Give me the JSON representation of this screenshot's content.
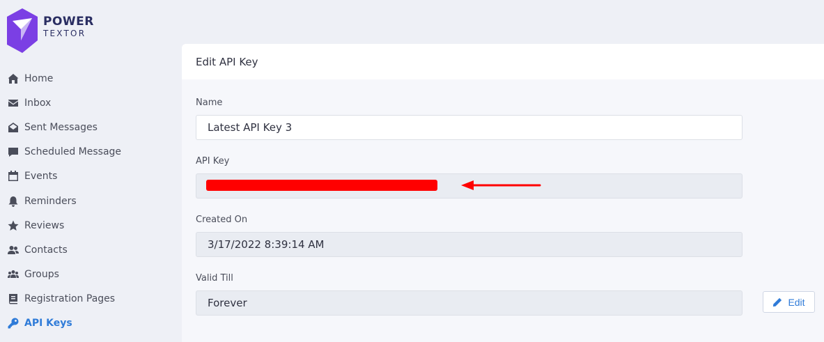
{
  "brand": {
    "line1": "POWER",
    "line2": "TEXTOR",
    "colors": {
      "dark": "#2a2e62",
      "purple": "#7b3fe4"
    }
  },
  "sidebar": {
    "items": [
      {
        "label": "Home",
        "icon": "home-icon",
        "active": false
      },
      {
        "label": "Inbox",
        "icon": "envelope-icon",
        "active": false
      },
      {
        "label": "Sent Messages",
        "icon": "envelope-open-icon",
        "active": false
      },
      {
        "label": "Scheduled Message",
        "icon": "comment-icon",
        "active": false
      },
      {
        "label": "Events",
        "icon": "calendar-icon",
        "active": false
      },
      {
        "label": "Reminders",
        "icon": "bell-icon",
        "active": false
      },
      {
        "label": "Reviews",
        "icon": "star-icon",
        "active": false
      },
      {
        "label": "Contacts",
        "icon": "users-icon",
        "active": false
      },
      {
        "label": "Groups",
        "icon": "users-group-icon",
        "active": false
      },
      {
        "label": "Registration Pages",
        "icon": "book-icon",
        "active": false
      },
      {
        "label": "API Keys",
        "icon": "key-icon",
        "active": true
      }
    ],
    "active_color": "#2f7bd8"
  },
  "card": {
    "title": "Edit API Key",
    "fields": {
      "name": {
        "label": "Name",
        "value": "Latest API Key 3"
      },
      "api_key": {
        "label": "API Key",
        "value": "",
        "redaction_color": "#ff0000"
      },
      "created_on": {
        "label": "Created On",
        "value": "3/17/2022 8:39:14 AM"
      },
      "valid_till": {
        "label": "Valid Till",
        "value": "Forever"
      }
    },
    "edit_button": {
      "label": "Edit",
      "icon": "pencil-icon"
    }
  }
}
